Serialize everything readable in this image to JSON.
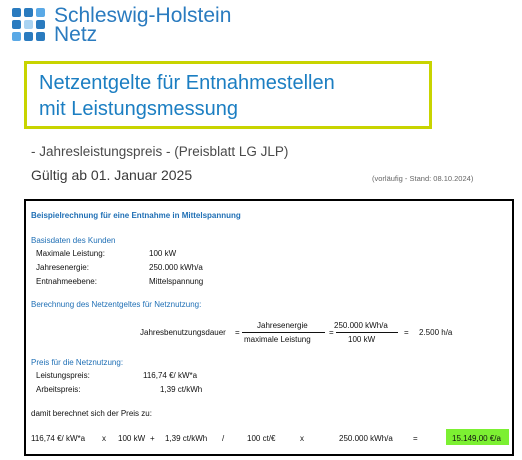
{
  "brand": {
    "name_line1": "Schleswig-Holstein",
    "name_line2": "Netz",
    "color": "#2a7bbf"
  },
  "header": {
    "title_line1": "Netzentgelte für Entnahmestellen",
    "title_line2": "mit Leistungsmessung",
    "subtitle": "- Jahresleistungspreis - (Preisblatt LG JLP)",
    "validity": "Gültig ab 01. Januar 2025",
    "status": "(vorläufig - Stand: 08.10.2024)",
    "frame_color": "#c8d400",
    "title_color": "#1b7ec2"
  },
  "example": {
    "heading": "Beispielrechnung für eine Entnahme in Mittelspannung",
    "base_heading": "Basisdaten des Kunden",
    "base_rows": [
      {
        "label": "Maximale Leistung:",
        "value": "100 kW"
      },
      {
        "label": "Jahresenergie:",
        "value": "250.000 kWh/a"
      },
      {
        "label": "Entnahmeebene:",
        "value": "Mittelspannung"
      }
    ],
    "calc_heading": "Berechnung des Netzentgeltes für Netznutzung:",
    "formula": {
      "lhs": "Jahresbenutzungsdauer",
      "eq1": "=",
      "num1": "Jahresenergie",
      "den1": "maximale Leistung",
      "eq2": "=",
      "num2": "250.000 kWh/a",
      "den2": "100 kW",
      "eq3": "=",
      "result": "2.500 h/a"
    },
    "price_heading": "Preis für die Netznutzung:",
    "price_rows": [
      {
        "label": "Leistungspreis:",
        "value": "116,74 €/ kW*a"
      },
      {
        "label": "Arbeitspreis:",
        "value": "1,39 ct/kWh"
      }
    ],
    "result_intro": "damit berechnet sich der Preis zu:",
    "result_line": {
      "t1": "116,74 €/ kW*a",
      "t2": "x",
      "t3": "100 kW",
      "t4": "+",
      "t5": "1,39 ct/kWh",
      "t6": "/",
      "t7": "100 ct/€",
      "t8": "x",
      "t9": "250.000 kWh/a",
      "t10": "=",
      "total": "15.149,00 €/a"
    },
    "highlight_color": "#7cf032",
    "section_color": "#1f6fb5"
  }
}
